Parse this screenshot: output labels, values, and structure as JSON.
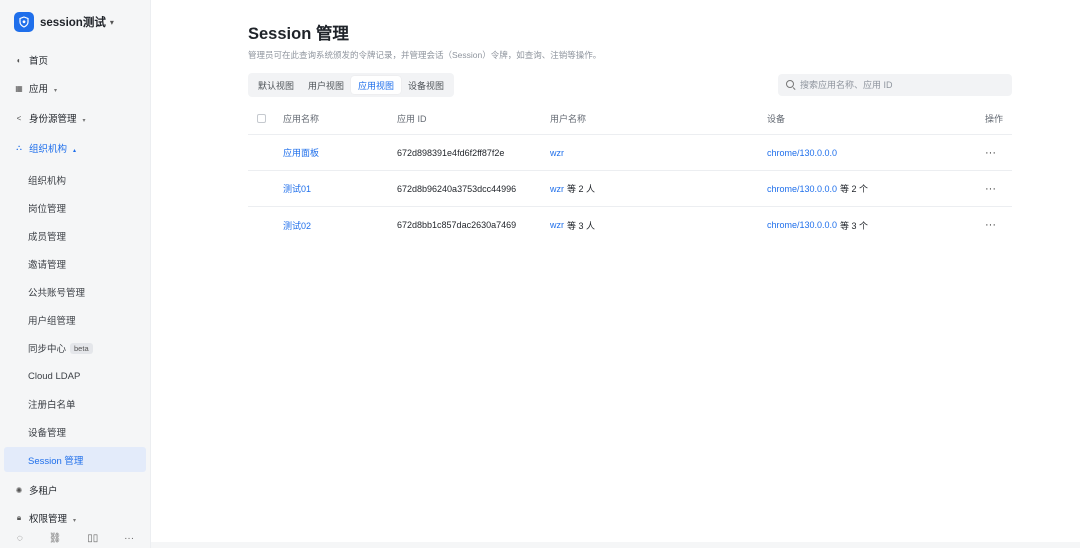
{
  "app": {
    "name": "session测试"
  },
  "sidebar": {
    "items": [
      {
        "label": "首页",
        "icon": "home-icon"
      },
      {
        "label": "应用",
        "icon": "apps-icon",
        "caret": "▾"
      },
      {
        "label": "身份源管理",
        "icon": "share-icon",
        "caret": "▾"
      },
      {
        "label": "组织机构",
        "icon": "org-icon",
        "caret": "▴"
      }
    ],
    "sub_items": [
      {
        "label": "组织机构"
      },
      {
        "label": "岗位管理"
      },
      {
        "label": "成员管理"
      },
      {
        "label": "邀请管理"
      },
      {
        "label": "公共账号管理"
      },
      {
        "label": "用户组管理"
      },
      {
        "label": "同步中心",
        "badge": "beta"
      },
      {
        "label": "Cloud LDAP"
      },
      {
        "label": "注册白名单"
      },
      {
        "label": "设备管理"
      },
      {
        "label": "Session 管理"
      }
    ],
    "bottom_items": [
      {
        "label": "多租户",
        "icon": "tenant-icon"
      },
      {
        "label": "权限管理",
        "icon": "lock-icon",
        "caret": "▾"
      }
    ]
  },
  "page": {
    "title": "Session 管理",
    "description": "管理员可在此查询系统颁发的令牌记录，并管理会话（Session）令牌，如查询、注销等操作。"
  },
  "tabs": [
    {
      "label": "默认视图"
    },
    {
      "label": "用户视图"
    },
    {
      "label": "应用视图"
    },
    {
      "label": "设备视图"
    }
  ],
  "search": {
    "placeholder": "搜索应用名称、应用 ID"
  },
  "table": {
    "headers": {
      "name": "应用名称",
      "app_id": "应用 ID",
      "user": "用户名称",
      "device": "设备",
      "op": "操作"
    },
    "rows": [
      {
        "name": "应用面板",
        "app_id": "672d898391e4fd6f2ff87f2e",
        "user": "wzr",
        "user_suffix": "",
        "device": "chrome/130.0.0.0",
        "device_suffix": "",
        "op": "···"
      },
      {
        "name": "测试01",
        "app_id": "672d8b96240a3753dcc44996",
        "user": "wzr",
        "user_suffix": "等 2 人",
        "device": "chrome/130.0.0.0",
        "device_suffix": "等 2 个",
        "op": "···"
      },
      {
        "name": "测试02",
        "app_id": "672d8bb1c857dac2630a7469",
        "user": "wzr",
        "user_suffix": "等 3 人",
        "device": "chrome/130.0.0.0",
        "device_suffix": "等 3 个",
        "op": "···"
      }
    ]
  },
  "colors": {
    "accent": "#1f6feb",
    "sidebar_bg": "#f5f6f7",
    "active_bg": "#e3ebfa"
  }
}
